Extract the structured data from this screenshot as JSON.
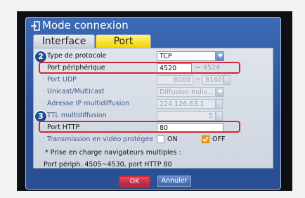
{
  "dialog": {
    "title": "Mode connexion",
    "title_icon": "login-icon",
    "tabs": [
      {
        "label": "Interface",
        "active": false
      },
      {
        "label": "Port",
        "active": true
      }
    ]
  },
  "badges": {
    "one": "2",
    "two": "3"
  },
  "settings": {
    "protocol": {
      "label": "Type de protocole",
      "value": "TCP"
    },
    "device_port": {
      "label": "Port périphérique",
      "value": "4520",
      "range_sep": "~",
      "range_end": "4524"
    },
    "udp_port": {
      "label": "Port UDP",
      "value": "8000",
      "range_sep": "~",
      "range_end": "8160"
    },
    "unicast": {
      "label": "Unicast/Multicast",
      "value": "Diffusion Indiv..."
    },
    "multicast_ip": {
      "label": "Adresse IP multidiffusion",
      "value": "224.126.63.1"
    },
    "ttl": {
      "label": "TTL multidiffusion",
      "value": "5"
    },
    "http_port": {
      "label": "Port HTTP",
      "value": "80"
    },
    "protected_video": {
      "label": "Transmission en vidéo protégée",
      "on_label": "ON",
      "off_label": "OFF",
      "selected": "OFF"
    }
  },
  "notes": {
    "line1": "* Prise en charge navigateurs multiples :",
    "line2": "Port périph. 4505~4530, port HTTP 80"
  },
  "buttons": {
    "ok": "OK",
    "cancel": "Annuler"
  },
  "colors": {
    "highlight": "#d6262f",
    "tab_active": "#f4d300",
    "checkbox_on": "#f39b16"
  }
}
